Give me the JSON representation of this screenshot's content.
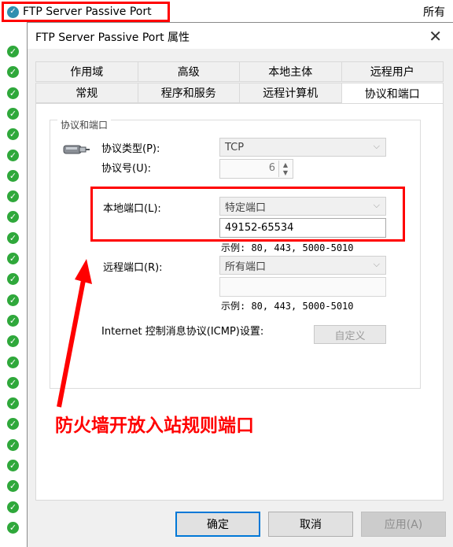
{
  "background": {
    "title": "FTP Server Passive Port",
    "right_text": "所有"
  },
  "dialog": {
    "title": "FTP Server Passive Port 属性",
    "tabs_row1": [
      "作用域",
      "高级",
      "本地主体",
      "远程用户"
    ],
    "tabs_row2": [
      "常规",
      "程序和服务",
      "远程计算机",
      "协议和端口"
    ],
    "active_tab": "协议和端口",
    "group_label": "协议和端口",
    "protocol_type_label": "协议类型(P):",
    "protocol_type_value": "TCP",
    "protocol_number_label": "协议号(U):",
    "protocol_number_value": "6",
    "local_port_label": "本地端口(L):",
    "local_port_select": "特定端口",
    "local_port_value": "49152-65534",
    "local_port_example": "示例: 80, 443, 5000-5010",
    "remote_port_label": "远程端口(R):",
    "remote_port_select": "所有端口",
    "remote_port_value": "",
    "remote_port_example": "示例: 80, 443, 5000-5010",
    "icmp_label": "Internet 控制消息协议(ICMP)设置:",
    "custom_button": "自定义",
    "ok_button": "确定",
    "cancel_button": "取消",
    "apply_button": "应用(A)"
  },
  "annotation": {
    "text": "防火墙开放入站规则端口",
    "color": "#ff0000"
  },
  "icons": {
    "status_check": "check-icon",
    "protocol": "network-cable-icon",
    "close": "close-icon"
  }
}
